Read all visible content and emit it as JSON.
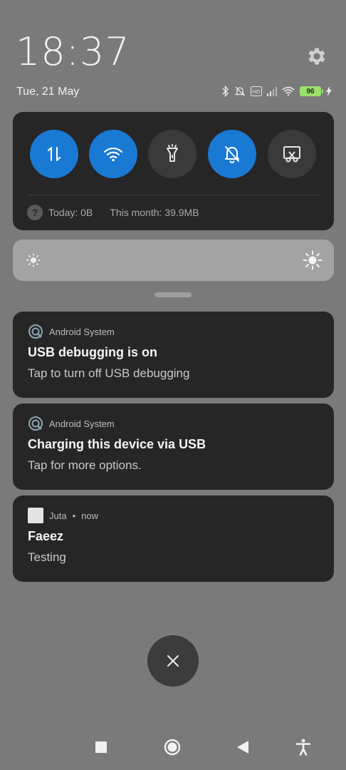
{
  "header": {
    "time": "18:37",
    "date": "Tue, 21 May",
    "battery_level": "96"
  },
  "status_icons": [
    "bluetooth-icon",
    "dnd-icon",
    "volte-icon",
    "signal-icon",
    "wifi-icon",
    "battery-icon",
    "charging-icon"
  ],
  "quick_settings": {
    "tiles": [
      {
        "name": "mobile-data",
        "state": "on"
      },
      {
        "name": "wifi",
        "state": "on"
      },
      {
        "name": "flashlight",
        "state": "off"
      },
      {
        "name": "mute",
        "state": "on"
      },
      {
        "name": "screenshot",
        "state": "off"
      }
    ],
    "data_usage": {
      "icon_text": "?",
      "today": "Today: 0B",
      "month": "This month: 39.9MB"
    }
  },
  "brightness": {
    "level": 0.0
  },
  "notifications": [
    {
      "app": "Android System",
      "title": "USB debugging is on",
      "text": "Tap to turn off USB debugging"
    },
    {
      "app": "Android System",
      "title": "Charging this device via USB",
      "text": "Tap for more options."
    },
    {
      "app": "Juta",
      "time": "now",
      "separator": "•",
      "title": "Faeez",
      "text": "Testing"
    }
  ],
  "colors": {
    "background": "#7a7a7a",
    "panel": "#262626",
    "accent": "#1a79d3",
    "battery": "#9be06a"
  }
}
